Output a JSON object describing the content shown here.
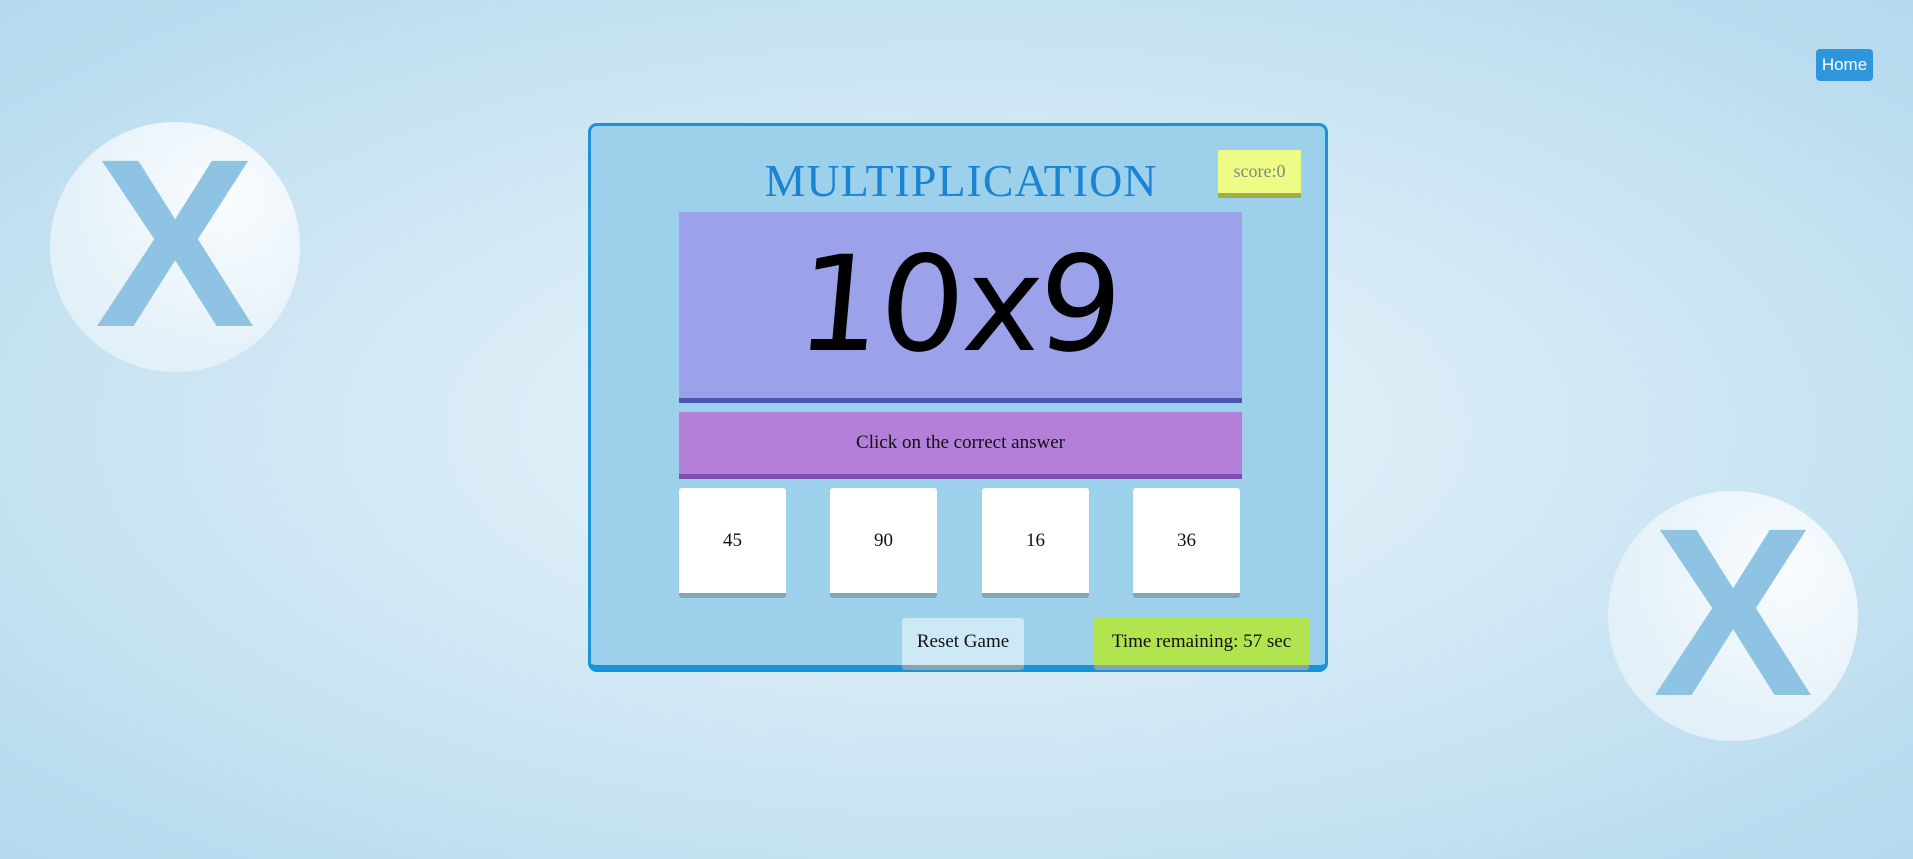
{
  "header": {
    "home_label": "Home"
  },
  "decorations": {
    "left_symbol": "X",
    "right_symbol": "X"
  },
  "game": {
    "title": "MULTIPLICATION",
    "score_text": "score:0",
    "question": "10x9",
    "instruction": "Click on the correct answer",
    "answers": [
      "45",
      "90",
      "16",
      "36"
    ],
    "reset_label": "Reset Game",
    "timer_text": "Time remaining: 57 sec"
  },
  "colors": {
    "accent_blue": "#1a94d8",
    "title_blue": "#1a84d2",
    "panel_bg": "#9dd0ea",
    "question_bg": "#9ca2e9",
    "instruction_bg": "#b47fd8",
    "score_bg": "#eefc86",
    "timer_bg": "#b2e44f",
    "home_bg": "#2f96dc"
  }
}
